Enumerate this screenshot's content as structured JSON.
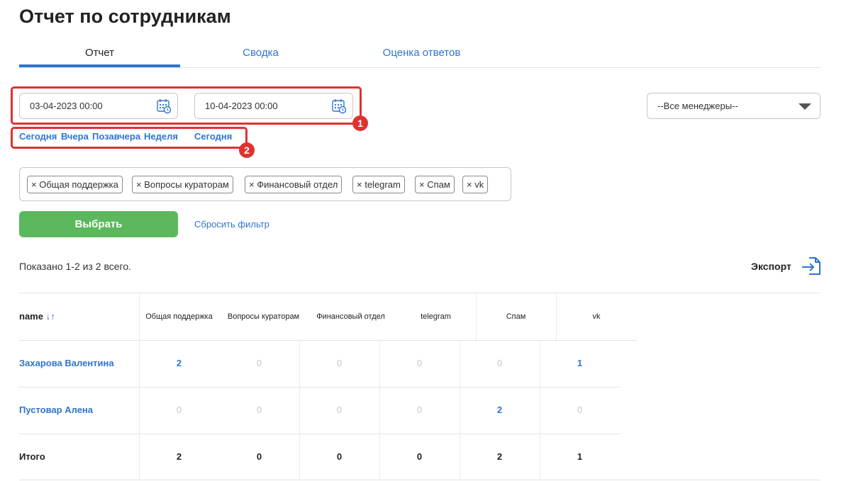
{
  "page": {
    "title": "Отчет по сотрудникам"
  },
  "tabs": [
    {
      "label": "Отчет",
      "active": true
    },
    {
      "label": "Сводка",
      "active": false
    },
    {
      "label": "Оценка ответов",
      "active": false
    }
  ],
  "filters": {
    "date_from": "03-04-2023 00:00",
    "date_to": "10-04-2023 00:00",
    "calendar_icon": "calendar-icon",
    "quick_ranges": [
      "Сегодня",
      "Вчера",
      "Позавчера",
      "Неделя"
    ],
    "quick_to": "Сегодня",
    "manager_select": "--Все менеджеры--",
    "tags": [
      "Общая поддержка",
      "Вопросы кураторам",
      "Финансовый отдел",
      "telegram",
      "Спам",
      "vk"
    ],
    "tag_remove_symbol": "×",
    "apply_label": "Выбрать",
    "reset_label": "Сбросить фильтр"
  },
  "annotations": [
    "1",
    "2"
  ],
  "colors": {
    "accent": "#2f74d0",
    "annotation": "#e03131",
    "button": "#5cb85c",
    "muted": "#c6c6c6"
  },
  "summary": "Показано 1-2 из 2 всего.",
  "export_label": "Экспорт",
  "table": {
    "name_header": "name",
    "sort_icon": "↓↑",
    "columns": [
      "Общая поддержка",
      "Вопросы кураторам",
      "Финансовый отдел",
      "telegram",
      "Спам",
      "vk"
    ],
    "rows": [
      {
        "name": "Захарова Валентина",
        "values": [
          "2",
          "0",
          "0",
          "0",
          "0",
          "1"
        ]
      },
      {
        "name": "Пустовар Алена",
        "values": [
          "0",
          "0",
          "0",
          "0",
          "2",
          "0"
        ]
      }
    ],
    "total": {
      "label": "Итого",
      "values": [
        "2",
        "0",
        "0",
        "0",
        "2",
        "1"
      ]
    }
  }
}
